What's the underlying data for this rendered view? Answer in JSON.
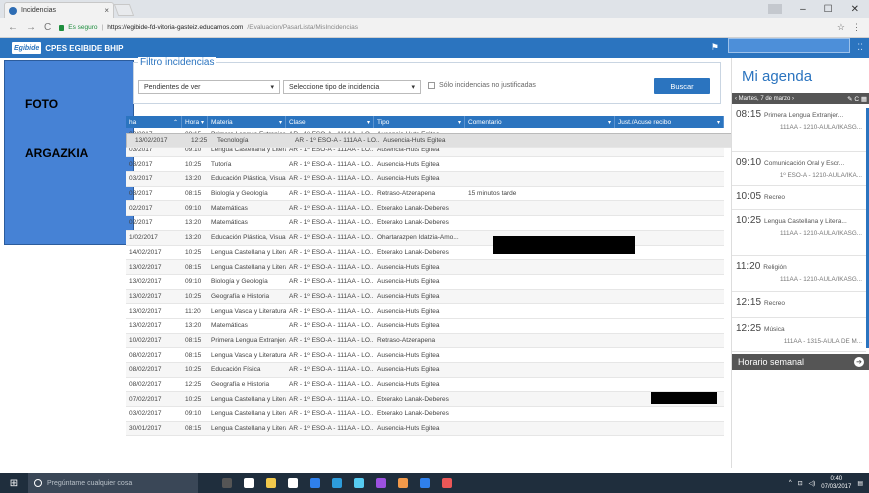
{
  "browser": {
    "tab_title": "Incidencias",
    "url_secure": "Es seguro",
    "url_host": "https://egibide-fd-vitoria-gasteiz.educamos.com",
    "url_path": "/Evaluacion/PasarLista/MisIncidencias"
  },
  "header": {
    "logo": "Egibide",
    "app_name": "CPES EGIBIDE BHIP"
  },
  "photo": {
    "line1": "FOTO",
    "line2": "ARGAZKIA"
  },
  "filter": {
    "legend": "Filtro incidencias",
    "status_select": "Pendientes de ver",
    "type_placeholder": "Seleccione tipo de incidencia",
    "unjustified_label": "Sólo incidencias no justificadas",
    "search_button": "Buscar"
  },
  "table": {
    "headers": [
      "ha",
      "Hora",
      "Materia",
      "Clase",
      "Tipo",
      "Comentario",
      "Just./Acuse recibo"
    ],
    "rows": [
      [
        "03/2017",
        "08:15",
        "Primera Lengua Extranjera...",
        "AR - 1º ESO-A - 111AA - LO...",
        "Ausencia-Huts Egitea",
        ""
      ],
      [
        "03/2017",
        "09:10",
        "Lengua Castellana y Litera...",
        "AR - 1º ESO-A - 111AA - LO...",
        "Ausencia-Huts Egitea",
        ""
      ],
      [
        "03/2017",
        "10:25",
        "Tutoría",
        "AR - 1º ESO-A - 111AA - LO...",
        "Ausencia-Huts Egitea",
        ""
      ],
      [
        "03/2017",
        "13:20",
        "Educación Plástica, Visual ...",
        "AR - 1º ESO-A - 111AA - LO...",
        "Ausencia-Huts Egitea",
        ""
      ],
      [
        "03/2017",
        "08:15",
        "Biología y Geología",
        "AR - 1º ESO-A - 111AA - LO...",
        "Retraso-Atzerapena",
        "15 minutos tarde"
      ],
      [
        "02/2017",
        "09:10",
        "Matemáticas",
        "AR - 1º ESO-A - 111AA - LO...",
        "Etxerako Lanak-Deberes",
        ""
      ],
      [
        "02/2017",
        "13:20",
        "Matemáticas",
        "AR - 1º ESO-A - 111AA - LO...",
        "Etxerako Lanak-Deberes",
        ""
      ],
      [
        "1/02/2017",
        "13:20",
        "Educación Plástica, Visual ...",
        "AR - 1º ESO-A - 111AA - LO...",
        "Ohartarazpen Idatzia-Amo...",
        ""
      ],
      [
        "14/02/2017",
        "10:25",
        "Lengua Castellana y Litera...",
        "AR - 1º ESO-A - 111AA - LO...",
        "Etxerako Lanak-Deberes",
        ""
      ],
      [
        "13/02/2017",
        "08:15",
        "Lengua Castellana y Litera...",
        "AR - 1º ESO-A - 111AA - LO...",
        "Ausencia-Huts Egitea",
        ""
      ],
      [
        "13/02/2017",
        "09:10",
        "Biología y Geología",
        "AR - 1º ESO-A - 111AA - LO...",
        "Ausencia-Huts Egitea",
        ""
      ],
      [
        "13/02/2017",
        "10:25",
        "Geografía e Historia",
        "AR - 1º ESO-A - 111AA - LO...",
        "Ausencia-Huts Egitea",
        ""
      ],
      [
        "13/02/2017",
        "11:20",
        "Lengua Vasca y Literatura",
        "AR - 1º ESO-A - 111AA - LO...",
        "Ausencia-Huts Egitea",
        ""
      ],
      [
        "13/02/2017",
        "12:25",
        "Tecnología",
        "AR - 1º ESO-A - 111AA - LO...",
        "Ausencia-Huts Egitea",
        ""
      ],
      [
        "13/02/2017",
        "13:20",
        "Matemáticas",
        "AR - 1º ESO-A - 111AA - LO...",
        "Ausencia-Huts Egitea",
        ""
      ],
      [
        "10/02/2017",
        "08:15",
        "Primera Lengua Extranjera...",
        "AR - 1º ESO-A - 111AA - LO...",
        "Retraso-Atzerapena",
        ""
      ],
      [
        "08/02/2017",
        "08:15",
        "Lengua Vasca y Literatura",
        "AR - 1º ESO-A - 111AA - LO...",
        "Ausencia-Huts Egitea",
        ""
      ],
      [
        "08/02/2017",
        "10:25",
        "Educación Física",
        "AR - 1º ESO-A - 111AA - LO...",
        "Ausencia-Huts Egitea",
        ""
      ],
      [
        "08/02/2017",
        "12:25",
        "Geografía e Historia",
        "AR - 1º ESO-A - 111AA - LO...",
        "Ausencia-Huts Egitea",
        ""
      ],
      [
        "07/02/2017",
        "10:25",
        "Lengua Castellana y Litera...",
        "AR - 1º ESO-A - 111AA - LO...",
        "Etxerako Lanak-Deberes",
        ""
      ],
      [
        "03/02/2017",
        "09:10",
        "Lengua Castellana y Litera...",
        "AR - 1º ESO-A - 111AA - LO...",
        "Etxerako Lanak-Deberes",
        ""
      ],
      [
        "30/01/2017",
        "08:15",
        "Lengua Castellana y Litera...",
        "AR - 1º ESO-A - 111AA - LO...",
        "Ausencia-Huts Egitea",
        ""
      ]
    ]
  },
  "agenda": {
    "title": "Mi agenda",
    "date": "‹ Martes, 7 de marzo ›",
    "icons": "✎ C ▦",
    "slots": [
      {
        "time": "08:15",
        "subject": "Primera Lengua Extranjer...",
        "location": "111AA - 1210-AULA/IKASG..."
      },
      {
        "time": "09:10",
        "subject": "Comunicación Oral y Escr...",
        "location": "1º ESO-A - 1210-AULA/IKA..."
      },
      {
        "time": "10:05",
        "subject": "Recreo",
        "location": ""
      },
      {
        "time": "10:25",
        "subject": "Lengua Castellana y Litera...",
        "location": "111AA - 1210-AULA/IKASG..."
      },
      {
        "time": "11:20",
        "subject": "Religión",
        "location": "111AA - 1210-AULA/IKASG..."
      },
      {
        "time": "12:15",
        "subject": "Recreo",
        "location": ""
      },
      {
        "time": "12:25",
        "subject": "Música",
        "location": "111AA - 1315-AULA DE M..."
      }
    ],
    "weekly": "Horario semanal"
  },
  "taskbar": {
    "search_placeholder": "Pregúntame cualquier cosa",
    "time": "0:40",
    "date": "07/03/2017"
  },
  "colors": {
    "brand": "#2b74bf",
    "header_dark": "#555555",
    "taskbar": "#1f2e3d"
  }
}
